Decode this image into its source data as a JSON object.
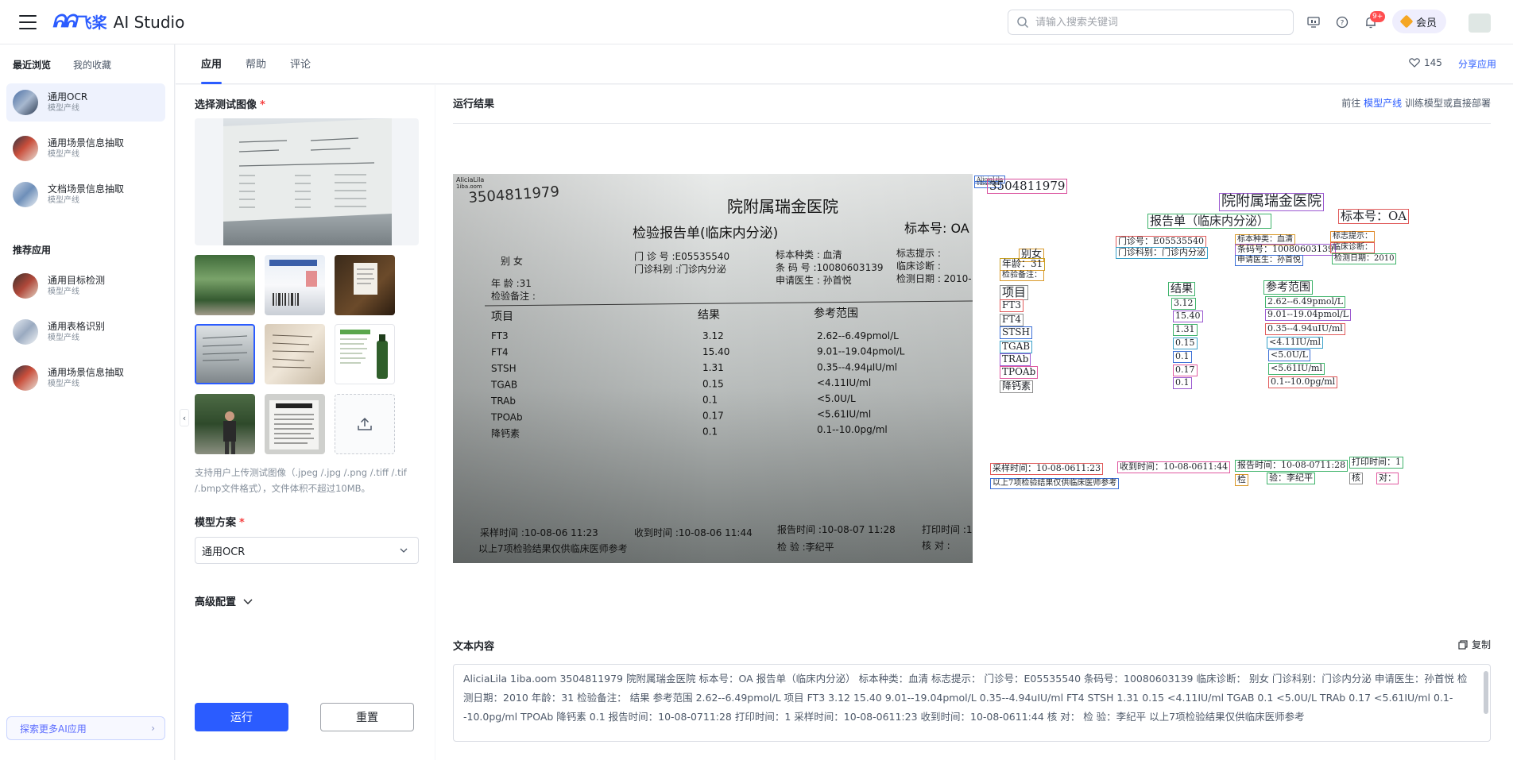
{
  "header": {
    "logo_mark": "ᕱᕱ",
    "logo_cn": "飞桨",
    "logo_en": "AI Studio",
    "search_placeholder": "请输入搜索关键词",
    "notify_badge": "9+",
    "vip_label": "会员"
  },
  "sidebar": {
    "tabs": [
      "最近浏览",
      "我的收藏"
    ],
    "recent": [
      {
        "title": "通用OCR",
        "sub": "模型产线"
      },
      {
        "title": "通用场景信息抽取",
        "sub": "模型产线"
      },
      {
        "title": "文档场景信息抽取",
        "sub": "模型产线"
      }
    ],
    "recommend_title": "推荐应用",
    "recommend": [
      {
        "title": "通用目标检测",
        "sub": "模型产线"
      },
      {
        "title": "通用表格识别",
        "sub": "模型产线"
      },
      {
        "title": "通用场景信息抽取",
        "sub": "模型产线"
      }
    ],
    "explore_label": "探索更多AI应用",
    "explore_chevron": "›"
  },
  "main_tabs": [
    "应用",
    "帮助",
    "评论"
  ],
  "likes": "145",
  "share_label": "分享应用",
  "config": {
    "image_label": "选择测试图像",
    "required_mark": "*",
    "hint": "支持用户上传测试图像（.jpeg /.jpg /.png /.tiff /.tif /.bmp文件格式），文件体积不超过10MB。",
    "model_label": "模型方案",
    "model_value": "通用OCR",
    "advanced_label": "高级配置",
    "run_label": "运行",
    "reset_label": "重置",
    "collapse_glyph": "‹"
  },
  "result": {
    "title": "运行结果",
    "tip_prefix": "前往",
    "tip_link": "模型产线",
    "tip_suffix": "训练模型或直接部署",
    "text_title": "文本内容",
    "copy_label": "复制",
    "text_content": "AliciaLila 1iba.oom 3504811979 院附属瑞金医院 标本号：OA 报告单（临床内分泌） 标本种类：血清 标志提示： 门诊号：E05535540 条码号：10080603139 临床诊断： 别女 门诊科别：门诊内分泌 申请医生：孙首悦 检测日期：2010 年龄：31 检验备注： 结果 参考范围 2.62--6.49pmol/L 项目 FT3 3.12 15.40 9.01--19.04pmol/L 0.35--4.94uIU/ml FT4 STSH 1.31 0.15 <4.11IU/ml TGAB 0.1 <5.0U/L TRAb 0.17 <5.61IU/ml 0.1--10.0pg/ml TPOAb 降钙素 0.1 报告时间：10-08-0711:28 打印时间：1 采样时间：10-08-0611:23 收到时间：10-08-0611:44 核 对： 检 验：李纪平 以上7项检验结果仅供临床医师参考"
  },
  "photo": {
    "top_ids": [
      "AliciaLila",
      "1iba.oom"
    ],
    "number": "3504811979",
    "hospital": "院附属瑞金医院",
    "report": "检验报告单(临床内分泌)",
    "sample_no": "标本号: OA",
    "info": [
      "门 诊 号 :E05535540",
      "门诊科别 :门诊内分泌",
      "标本种类 : 血清",
      "条 码 号 :10080603139",
      "申请医生 : 孙首悦",
      "标志提示 :",
      "临床诊断 :",
      "检测日期 : 2010-"
    ],
    "sex_age": [
      "别 女",
      "年  龄 :31",
      "检验备注 :"
    ],
    "headers": [
      "项目",
      "结果",
      "参考范围"
    ],
    "rows": [
      [
        "FT3",
        "3.12",
        "2.62--6.49pmol/L"
      ],
      [
        "FT4",
        "15.40",
        "9.01--19.04pmol/L"
      ],
      [
        "STSH",
        "1.31",
        "0.35--4.94µIU/ml"
      ],
      [
        "TGAB",
        "0.15",
        "<4.11IU/ml"
      ],
      [
        "TRAb",
        "0.1",
        "<5.0U/L"
      ],
      [
        "TPOAb",
        "0.17",
        "<5.61IU/ml"
      ],
      [
        "降钙素",
        "0.1",
        "0.1--10.0pg/ml"
      ]
    ],
    "footer": [
      "采样时间 :10-08-06 11:23",
      "收到时间 :10-08-06 11:44",
      "报告时间 :10-08-07 11:28",
      "打印时间 :1",
      "以上7项检验结果仅供临床医师参考",
      "检   验 :李纪平",
      "核   对 :"
    ]
  },
  "overlay": {
    "boxes": [
      {
        "text": "AliciaLila",
        "color": "#3b6fd6"
      },
      {
        "text": "1iba.oom",
        "color": "#3b6fd6"
      },
      {
        "text": "3504811979",
        "color": "#d94d9b"
      },
      {
        "text": "院附属瑞金医院",
        "color": "#9b59d0"
      },
      {
        "text": "标本号：OA",
        "color": "#e05a5a"
      },
      {
        "text": "报告单（临床内分泌）",
        "color": "#3fb36b"
      },
      {
        "text": "门诊号：E05535540",
        "color": "#e05a5a"
      },
      {
        "text": "门诊科别：门诊内分泌",
        "color": "#39a0c9"
      },
      {
        "text": "标本种类：血清",
        "color": "#d99a2b"
      },
      {
        "text": "条码号：10080603139",
        "color": "#9b59d0"
      },
      {
        "text": "申请医生：孙首悦",
        "color": "#3b6fd6"
      },
      {
        "text": "标志提示：",
        "color": "#e08a2b"
      },
      {
        "text": "临床诊断：",
        "color": "#e05a5a"
      },
      {
        "text": "检测日期：2010",
        "color": "#3fb36b"
      },
      {
        "text": "别女",
        "color": "#d99a2b"
      },
      {
        "text": "年龄：31",
        "color": "#c9a227"
      },
      {
        "text": "检验备注：",
        "color": "#d99a2b"
      },
      {
        "text": "项目",
        "color": "#8c8c8c"
      },
      {
        "text": "结果",
        "color": "#3fb36b"
      },
      {
        "text": "参考范围",
        "color": "#3fb36b"
      },
      {
        "text": "FT3",
        "color": "#e05a5a"
      },
      {
        "text": "FT4",
        "color": "#8c8c8c"
      },
      {
        "text": "STSH",
        "color": "#3b6fd6"
      },
      {
        "text": "TGAB",
        "color": "#39a0c9"
      },
      {
        "text": "TRAb",
        "color": "#9b59d0"
      },
      {
        "text": "TPOAb",
        "color": "#e05aa0"
      },
      {
        "text": "降钙素",
        "color": "#8c8c8c"
      },
      {
        "text": "3.12",
        "color": "#3fb36b"
      },
      {
        "text": "15.40",
        "color": "#9b59d0"
      },
      {
        "text": "1.31",
        "color": "#3fb36b"
      },
      {
        "text": "0.15",
        "color": "#39a0c9"
      },
      {
        "text": "0.1",
        "color": "#3b6fd6"
      },
      {
        "text": "0.17",
        "color": "#e05aa0"
      },
      {
        "text": "0.1",
        "color": "#9b59d0"
      },
      {
        "text": "2.62--6.49pmol/L",
        "color": "#3fb36b"
      },
      {
        "text": "9.01--19.04pmol/L",
        "color": "#9b59d0"
      },
      {
        "text": "0.35--4.94uIU/ml",
        "color": "#e05a5a"
      },
      {
        "text": "<4.11IU/ml",
        "color": "#39a0c9"
      },
      {
        "text": "<5.0U/L",
        "color": "#3b6fd6"
      },
      {
        "text": "<5.61IU/ml",
        "color": "#3fb36b"
      },
      {
        "text": "0.1--10.0pg/ml",
        "color": "#e05a5a"
      },
      {
        "text": "采样时间：10-08-0611:23",
        "color": "#e05a5a"
      },
      {
        "text": "以上7项检验结果仅供临床医师参考",
        "color": "#3b6fd6"
      },
      {
        "text": "收到时间：10-08-0611:44",
        "color": "#e05aa0"
      },
      {
        "text": "报告时间：10-08-0711:28",
        "color": "#3fb36b"
      },
      {
        "text": "检",
        "color": "#d99a2b"
      },
      {
        "text": "验：李纪平",
        "color": "#3fb36b"
      },
      {
        "text": "打印时间：1",
        "color": "#3fb36b"
      },
      {
        "text": "核",
        "color": "#8c8c8c"
      },
      {
        "text": "对：",
        "color": "#e05aa0"
      }
    ]
  }
}
